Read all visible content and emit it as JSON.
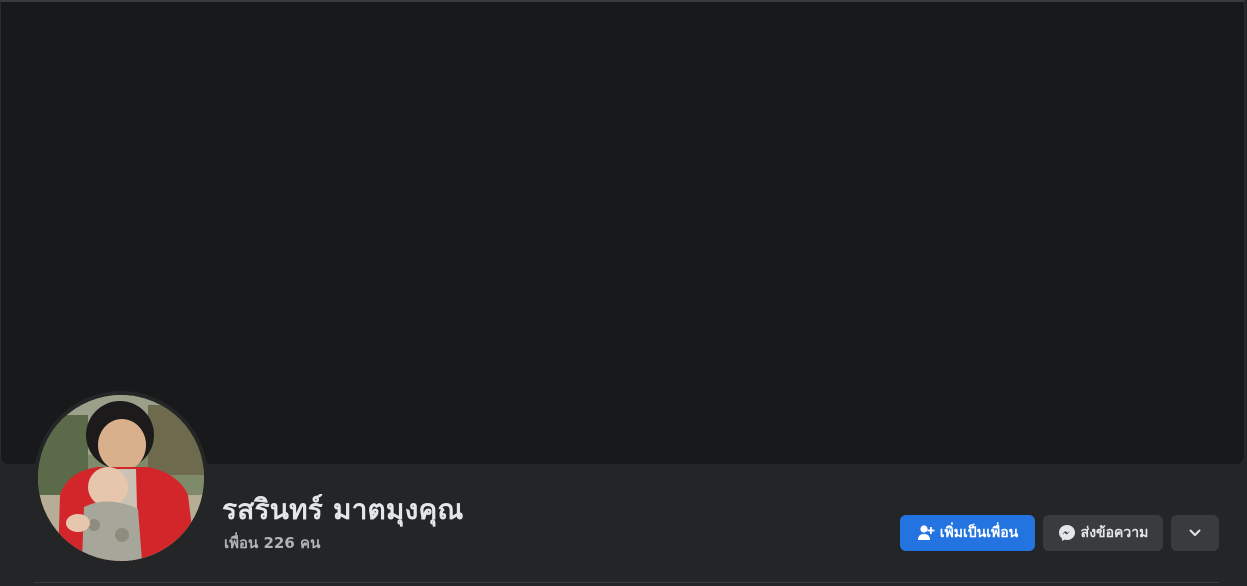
{
  "profile": {
    "name": "รสรินทร์ มาตมุงคุณ",
    "friends_label": "เพื่อน 226 คน"
  },
  "actions": {
    "add_friend_label": "เพิ่มเป็นเพื่อน",
    "message_label": "ส่งข้อความ"
  },
  "icons": {
    "add_friend": "add-friend-icon",
    "messenger": "messenger-icon",
    "more": "chevron-down-icon"
  },
  "colors": {
    "primary_button": "#2374e1",
    "secondary_button": "#3a3b3c",
    "cover_background": "#18191b",
    "page_background": "#242526"
  }
}
